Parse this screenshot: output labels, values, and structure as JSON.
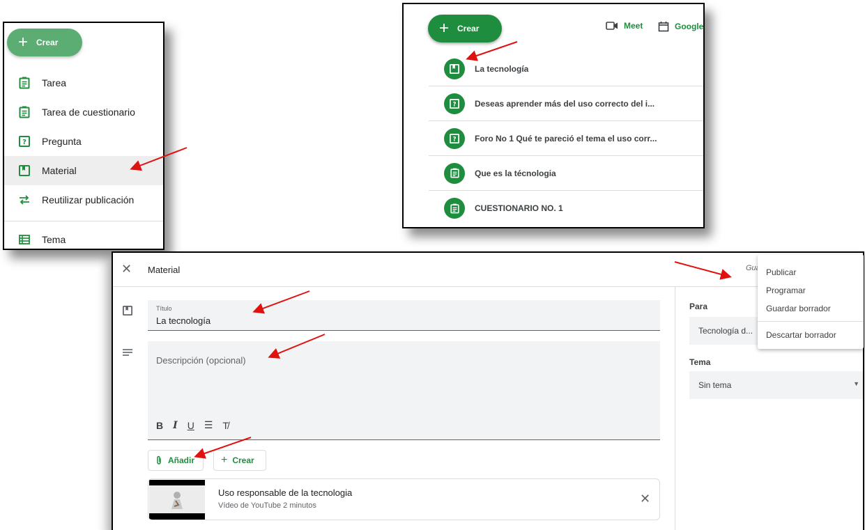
{
  "crear_menu": {
    "create_label": "Crear",
    "items": [
      {
        "label": "Tarea",
        "icon": "assignment-icon"
      },
      {
        "label": "Tarea de cuestionario",
        "icon": "quiz-assignment-icon"
      },
      {
        "label": "Pregunta",
        "icon": "question-icon"
      },
      {
        "label": "Material",
        "icon": "material-icon"
      },
      {
        "label": "Reutilizar publicación",
        "icon": "repeat-icon"
      },
      {
        "label": "Tema",
        "icon": "topic-icon"
      }
    ],
    "selected": "Material"
  },
  "stream": {
    "create_label": "Crear",
    "meet_label": "Meet",
    "calendar_label": "Google",
    "items": [
      {
        "title": "La tecnología",
        "icon": "material-icon"
      },
      {
        "title": "Deseas aprender más del uso correcto del i...",
        "icon": "question-icon"
      },
      {
        "title": "Foro No 1 Qué te pareció el tema el uso corr...",
        "icon": "question-icon"
      },
      {
        "title": "Que es la técnologia",
        "icon": "assignment-icon"
      },
      {
        "title": "CUESTIONARIO NO. 1",
        "icon": "assignment-icon"
      }
    ]
  },
  "editor": {
    "header_title": "Material",
    "header_status": "Gua",
    "title_label": "Título",
    "title_value": "La tecnología",
    "description_placeholder": "Descripción (opcional)",
    "format": {
      "bold": "B",
      "italic": "I",
      "underline": "U",
      "list": "☰",
      "clear": "T̸"
    },
    "add_label": "Añadir",
    "create_label": "Crear",
    "attachment": {
      "title": "Uso responsable de la tecnologia",
      "subtitle": "Vídeo de YouTube   2 minutos"
    },
    "sidebar": {
      "para_label": "Para",
      "para_value": "Tecnología d...",
      "tema_label": "Tema",
      "tema_value": "Sin tema"
    }
  },
  "publish_menu": {
    "items": [
      "Publicar",
      "Programar",
      "Guardar borrador",
      "Descartar borrador"
    ]
  },
  "colors": {
    "accent": "#1e8e3e",
    "arrow": "#e0120f"
  }
}
